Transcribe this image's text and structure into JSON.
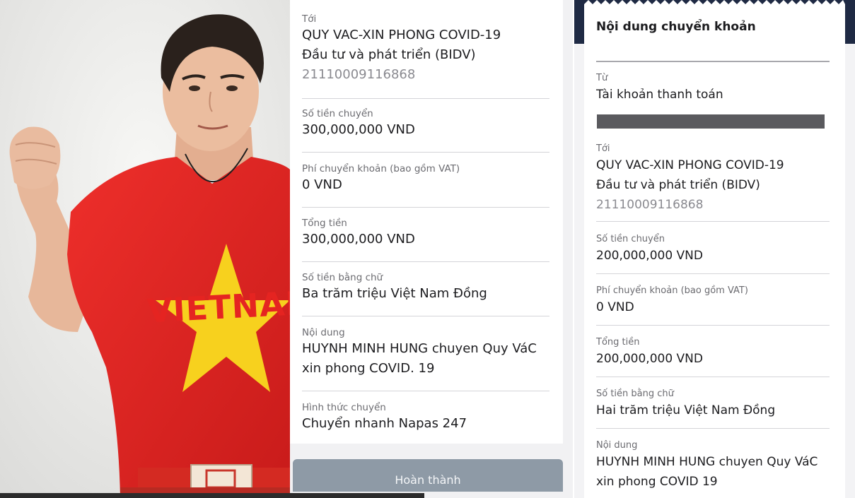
{
  "receipt_left": {
    "fields": [
      {
        "label": "Tới",
        "lines": [
          "QUY VAC-XIN PHONG COVID-19",
          "Đầu tư và phát triển (BIDV)"
        ],
        "account": "21110009116868"
      },
      {
        "label": "Số tiền chuyển",
        "value": "300,000,000 VND"
      },
      {
        "label": "Phí chuyển khoản (bao gồm VAT)",
        "value": "0 VND"
      },
      {
        "label": "Tổng tiền",
        "value": "300,000,000 VND"
      },
      {
        "label": "Số tiền bằng chữ",
        "value": "Ba trăm triệu Việt Nam Đồng"
      },
      {
        "label": "Nội dung",
        "lines": [
          "HUYNH MINH HUNG chuyen Quy VáC",
          "xin phong COVID.  19"
        ]
      },
      {
        "label": "Hình thức chuyển",
        "value": "Chuyển nhanh Napas 247"
      }
    ],
    "done_button": "Hoàn thành"
  },
  "receipt_right": {
    "title": "Nội dung chuyển khoản",
    "fields": [
      {
        "label": "Từ",
        "value": "Tài khoản thanh toán"
      },
      {
        "label": "Tới",
        "lines": [
          "QUY VAC-XIN PHONG COVID-19",
          "Đầu tư và phát triển (BIDV)"
        ],
        "account": "21110009116868"
      },
      {
        "label": "Số tiền chuyển",
        "value": "200,000,000 VND"
      },
      {
        "label": "Phí chuyển khoản (bao gồm VAT)",
        "value": "0 VND"
      },
      {
        "label": "Tổng tiền",
        "value": "200,000,000 VND"
      },
      {
        "label": "Số tiền bằng chữ",
        "value": "Hai trăm triệu Việt Nam Đồng"
      },
      {
        "label": "Nội dung",
        "lines": [
          "HUYNH MINH HUNG chuyen Quy VáC",
          "xin phong COVID 19"
        ]
      }
    ]
  },
  "photo": {
    "shirt_text": "VIETNAM"
  },
  "colors": {
    "shirt_red": "#e52421",
    "star_yellow": "#f7d11e",
    "header_navy": "#1f2a44",
    "button_gray": "#8e9aa6"
  }
}
